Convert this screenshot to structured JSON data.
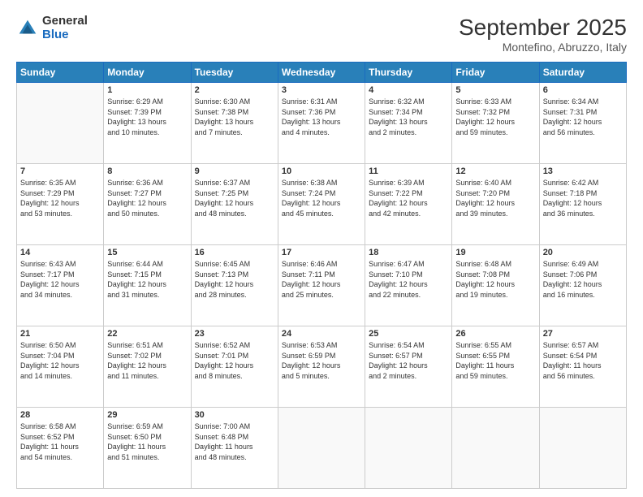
{
  "logo": {
    "general": "General",
    "blue": "Blue"
  },
  "header": {
    "month": "September 2025",
    "location": "Montefino, Abruzzo, Italy"
  },
  "days_of_week": [
    "Sunday",
    "Monday",
    "Tuesday",
    "Wednesday",
    "Thursday",
    "Friday",
    "Saturday"
  ],
  "weeks": [
    [
      {
        "day": "",
        "info": ""
      },
      {
        "day": "1",
        "info": "Sunrise: 6:29 AM\nSunset: 7:39 PM\nDaylight: 13 hours\nand 10 minutes."
      },
      {
        "day": "2",
        "info": "Sunrise: 6:30 AM\nSunset: 7:38 PM\nDaylight: 13 hours\nand 7 minutes."
      },
      {
        "day": "3",
        "info": "Sunrise: 6:31 AM\nSunset: 7:36 PM\nDaylight: 13 hours\nand 4 minutes."
      },
      {
        "day": "4",
        "info": "Sunrise: 6:32 AM\nSunset: 7:34 PM\nDaylight: 13 hours\nand 2 minutes."
      },
      {
        "day": "5",
        "info": "Sunrise: 6:33 AM\nSunset: 7:32 PM\nDaylight: 12 hours\nand 59 minutes."
      },
      {
        "day": "6",
        "info": "Sunrise: 6:34 AM\nSunset: 7:31 PM\nDaylight: 12 hours\nand 56 minutes."
      }
    ],
    [
      {
        "day": "7",
        "info": "Sunrise: 6:35 AM\nSunset: 7:29 PM\nDaylight: 12 hours\nand 53 minutes."
      },
      {
        "day": "8",
        "info": "Sunrise: 6:36 AM\nSunset: 7:27 PM\nDaylight: 12 hours\nand 50 minutes."
      },
      {
        "day": "9",
        "info": "Sunrise: 6:37 AM\nSunset: 7:25 PM\nDaylight: 12 hours\nand 48 minutes."
      },
      {
        "day": "10",
        "info": "Sunrise: 6:38 AM\nSunset: 7:24 PM\nDaylight: 12 hours\nand 45 minutes."
      },
      {
        "day": "11",
        "info": "Sunrise: 6:39 AM\nSunset: 7:22 PM\nDaylight: 12 hours\nand 42 minutes."
      },
      {
        "day": "12",
        "info": "Sunrise: 6:40 AM\nSunset: 7:20 PM\nDaylight: 12 hours\nand 39 minutes."
      },
      {
        "day": "13",
        "info": "Sunrise: 6:42 AM\nSunset: 7:18 PM\nDaylight: 12 hours\nand 36 minutes."
      }
    ],
    [
      {
        "day": "14",
        "info": "Sunrise: 6:43 AM\nSunset: 7:17 PM\nDaylight: 12 hours\nand 34 minutes."
      },
      {
        "day": "15",
        "info": "Sunrise: 6:44 AM\nSunset: 7:15 PM\nDaylight: 12 hours\nand 31 minutes."
      },
      {
        "day": "16",
        "info": "Sunrise: 6:45 AM\nSunset: 7:13 PM\nDaylight: 12 hours\nand 28 minutes."
      },
      {
        "day": "17",
        "info": "Sunrise: 6:46 AM\nSunset: 7:11 PM\nDaylight: 12 hours\nand 25 minutes."
      },
      {
        "day": "18",
        "info": "Sunrise: 6:47 AM\nSunset: 7:10 PM\nDaylight: 12 hours\nand 22 minutes."
      },
      {
        "day": "19",
        "info": "Sunrise: 6:48 AM\nSunset: 7:08 PM\nDaylight: 12 hours\nand 19 minutes."
      },
      {
        "day": "20",
        "info": "Sunrise: 6:49 AM\nSunset: 7:06 PM\nDaylight: 12 hours\nand 16 minutes."
      }
    ],
    [
      {
        "day": "21",
        "info": "Sunrise: 6:50 AM\nSunset: 7:04 PM\nDaylight: 12 hours\nand 14 minutes."
      },
      {
        "day": "22",
        "info": "Sunrise: 6:51 AM\nSunset: 7:02 PM\nDaylight: 12 hours\nand 11 minutes."
      },
      {
        "day": "23",
        "info": "Sunrise: 6:52 AM\nSunset: 7:01 PM\nDaylight: 12 hours\nand 8 minutes."
      },
      {
        "day": "24",
        "info": "Sunrise: 6:53 AM\nSunset: 6:59 PM\nDaylight: 12 hours\nand 5 minutes."
      },
      {
        "day": "25",
        "info": "Sunrise: 6:54 AM\nSunset: 6:57 PM\nDaylight: 12 hours\nand 2 minutes."
      },
      {
        "day": "26",
        "info": "Sunrise: 6:55 AM\nSunset: 6:55 PM\nDaylight: 11 hours\nand 59 minutes."
      },
      {
        "day": "27",
        "info": "Sunrise: 6:57 AM\nSunset: 6:54 PM\nDaylight: 11 hours\nand 56 minutes."
      }
    ],
    [
      {
        "day": "28",
        "info": "Sunrise: 6:58 AM\nSunset: 6:52 PM\nDaylight: 11 hours\nand 54 minutes."
      },
      {
        "day": "29",
        "info": "Sunrise: 6:59 AM\nSunset: 6:50 PM\nDaylight: 11 hours\nand 51 minutes."
      },
      {
        "day": "30",
        "info": "Sunrise: 7:00 AM\nSunset: 6:48 PM\nDaylight: 11 hours\nand 48 minutes."
      },
      {
        "day": "",
        "info": ""
      },
      {
        "day": "",
        "info": ""
      },
      {
        "day": "",
        "info": ""
      },
      {
        "day": "",
        "info": ""
      }
    ]
  ]
}
